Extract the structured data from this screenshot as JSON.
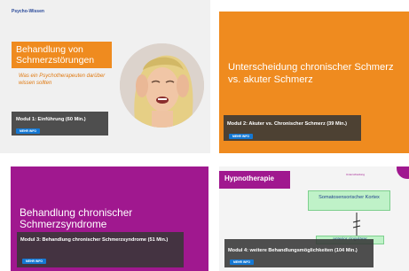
{
  "brand": {
    "label": "Psycho-Wissen"
  },
  "cards": [
    {
      "slide_title": "Behandlung von Schmerzstörungen",
      "slide_subtitle": "Was ein Psychotherapeuten darüber wissen sollten",
      "overlay_title": "Modul 1: Einführung (60 Min.)",
      "button": "Mehr Info"
    },
    {
      "slide_title": "Unterscheidung  chronischer Schmerz vs. akuter Schmerz",
      "overlay_title": "Modul 2: Akuter vs. Chronischer Schmerz (39 Min.)",
      "button": "Mehr Info"
    },
    {
      "slide_title": "Behandlung chronischer Schmerzsyndrome",
      "overlay_title": "Modul 3: Behandlung chronischer Schmerzsyndrome (51 Min.)",
      "button": "Mehr Info"
    },
    {
      "slide_title": "Hypnotherapie",
      "slide_small": "Unterscheidung",
      "diagram_box1": "Somatosensorischer Kortex",
      "diagram_box2": "anterior cingulärer",
      "overlay_title": "Modul 4: weitere Behandlungsmöglichkeiten (104 Min.)",
      "button": "Mehr Info"
    }
  ],
  "colors": {
    "orange": "#ef8b1f",
    "purple": "#a0188f",
    "button_blue": "#1478d4",
    "overlay": "#373737"
  }
}
